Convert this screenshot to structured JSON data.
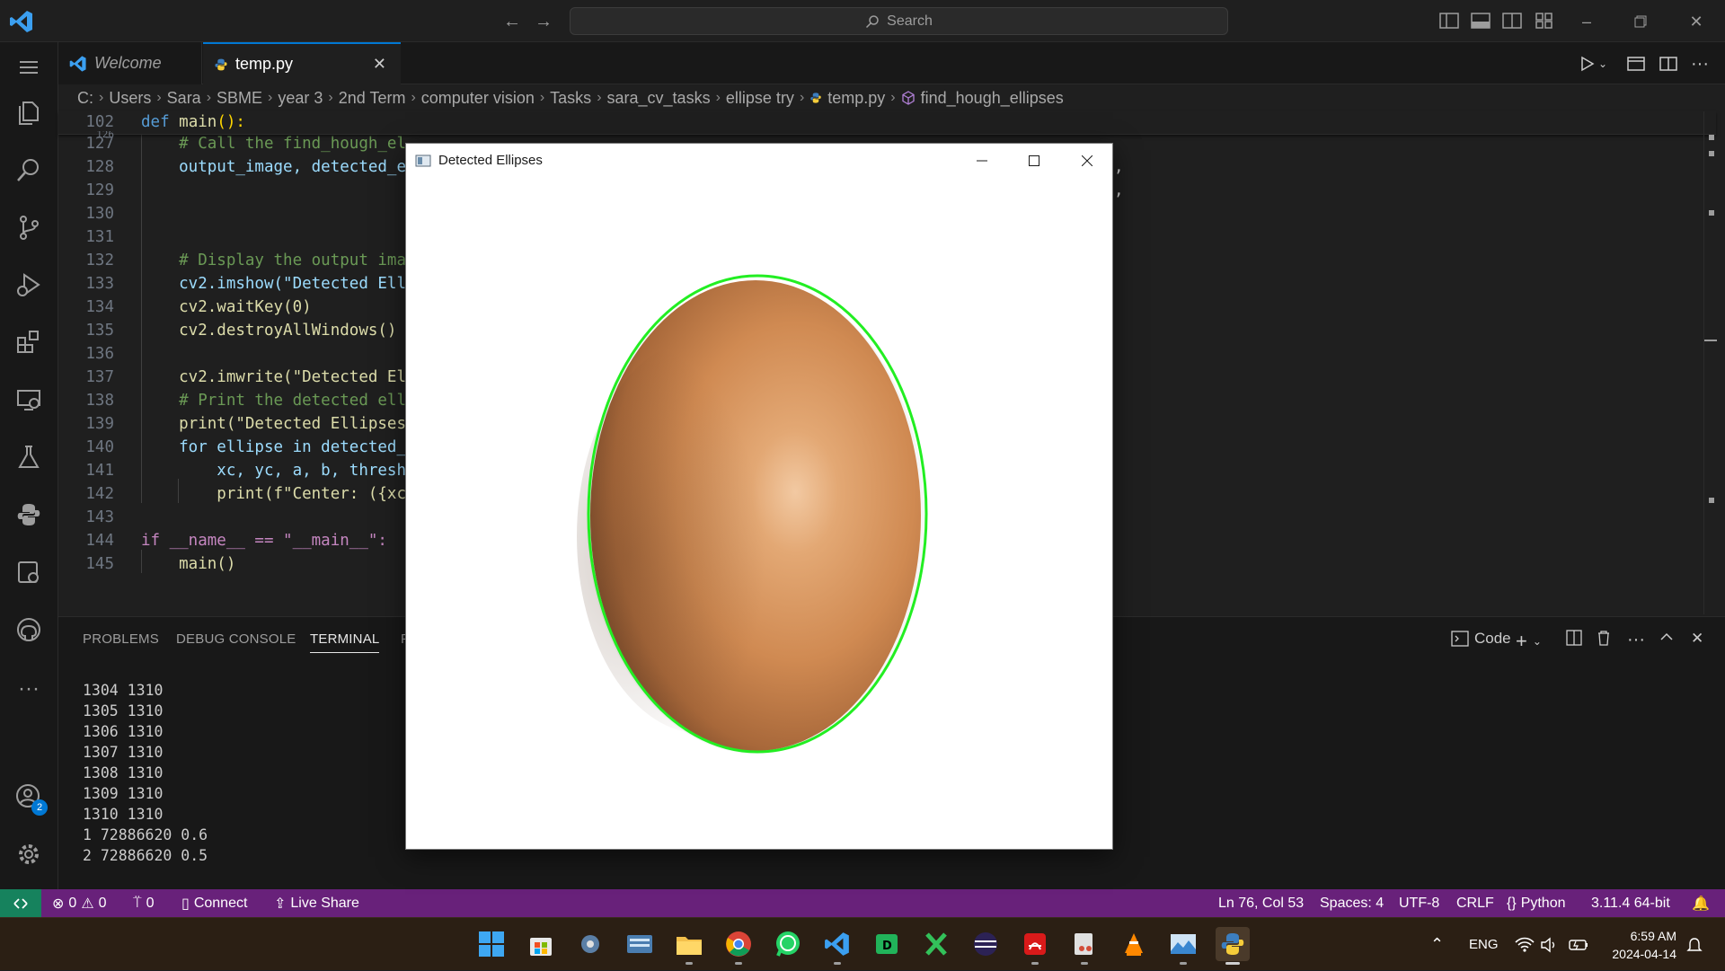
{
  "titlebar": {
    "search_placeholder": "Search"
  },
  "tabs": [
    {
      "label": "Welcome",
      "active": false
    },
    {
      "label": "temp.py",
      "active": true
    }
  ],
  "breadcrumb": [
    "C:",
    "Users",
    "Sara",
    "SBME",
    "year 3",
    "2nd Term",
    "computer vision",
    "Tasks",
    "sara_cv_tasks",
    "ellipse try",
    "temp.py",
    "find_hough_ellipses"
  ],
  "editor": {
    "sticky": {
      "line": "102",
      "def_kw": "def",
      "fn": "main",
      "rest": "():"
    },
    "sticky_hidden_line": "126",
    "lines": [
      {
        "n": "127",
        "text": "    # Call the find_hough_el"
      },
      {
        "n": "128",
        "text": "    output_image, detected_e"
      },
      {
        "n": "129",
        "text": ""
      },
      {
        "n": "130",
        "text": ""
      },
      {
        "n": "131",
        "text": ""
      },
      {
        "n": "132",
        "text": "    # Display the output imag"
      },
      {
        "n": "133",
        "text": "    cv2.imshow(\"Detected Ell"
      },
      {
        "n": "134",
        "text": "    cv2.waitKey(0)"
      },
      {
        "n": "135",
        "text": "    cv2.destroyAllWindows()"
      },
      {
        "n": "136",
        "text": ""
      },
      {
        "n": "137",
        "text": "    cv2.imwrite(\"Detected El"
      },
      {
        "n": "138",
        "text": "    # Print the detected ell"
      },
      {
        "n": "139",
        "text": "    print(\"Detected Ellipses"
      },
      {
        "n": "140",
        "text": "    for ellipse in detected_e"
      },
      {
        "n": "141",
        "text": "        xc, yc, a, b, thresh"
      },
      {
        "n": "142",
        "text": "        print(f\"Center: ({xc"
      },
      {
        "n": "143",
        "text": ""
      },
      {
        "n": "144",
        "text": "if __name__ == \"__main__\":"
      },
      {
        "n": "145",
        "text": "    main()"
      }
    ],
    "trailing_commas": [
      ",",
      ","
    ]
  },
  "panel": {
    "tabs": [
      "PROBLEMS",
      "DEBUG CONSOLE",
      "TERMINAL",
      "P"
    ],
    "active_tab": "TERMINAL",
    "terminal_profile": "Code",
    "terminal_lines": [
      "1304 1310",
      "1305 1310",
      "1306 1310",
      "1307 1310",
      "1308 1310",
      "1309 1310",
      "1310 1310",
      "1 72886620 0.6",
      "2 72886620 0.5"
    ]
  },
  "statusbar": {
    "errors": "0",
    "warnings": "0",
    "ports": "0",
    "connect": "Connect",
    "live_share": "Live Share",
    "cursor": "Ln 76, Col 53",
    "spaces": "Spaces: 4",
    "encoding": "UTF-8",
    "eol": "CRLF",
    "language": "Python",
    "interpreter": "3.11.4 64-bit"
  },
  "activitybar": {
    "accounts_badge": "2"
  },
  "cv_window": {
    "title": "Detected Ellipses"
  },
  "taskbar": {
    "language": "ENG",
    "time": "6:59 AM",
    "date": "2024-04-14",
    "apps": [
      "start-icon",
      "store-icon",
      "settings-icon",
      "keyboard-icon",
      "file-explorer-icon",
      "chrome-icon",
      "whatsapp-icon",
      "vscode-icon",
      "desktop-app-icon",
      "excel-like-icon",
      "eclipse-icon",
      "acrobat-icon",
      "snipping-tool-icon",
      "vlc-icon",
      "photos-icon",
      "python-icon"
    ]
  },
  "colors": {
    "statusbar": "#68217a",
    "remote": "#16825d",
    "accent": "#0078d4",
    "ellipse": "#22ee22",
    "egg": "#d89458"
  }
}
